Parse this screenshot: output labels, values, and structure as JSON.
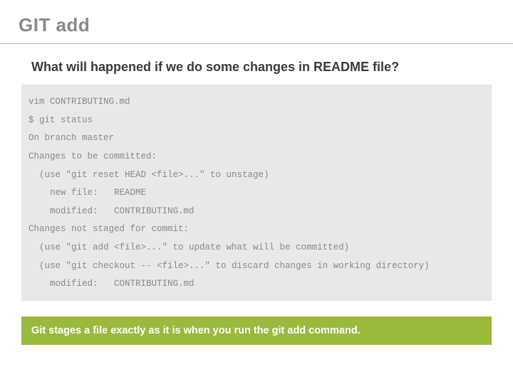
{
  "title": "GIT add",
  "subtitle": "What will happened if we do some changes in README file?",
  "code": "vim CONTRIBUTING.md\n$ git status\nOn branch master\nChanges to be committed:\n  (use \"git reset HEAD <file>...\" to unstage)\n    new file:   README\n    modified:   CONTRIBUTING.md\nChanges not staged for commit:\n  (use \"git add <file>...\" to update what will be committed)\n  (use \"git checkout -- <file>...\" to discard changes in working directory)\n    modified:   CONTRIBUTING.md",
  "callout": "Git stages a file exactly as it is when you run the git add command."
}
